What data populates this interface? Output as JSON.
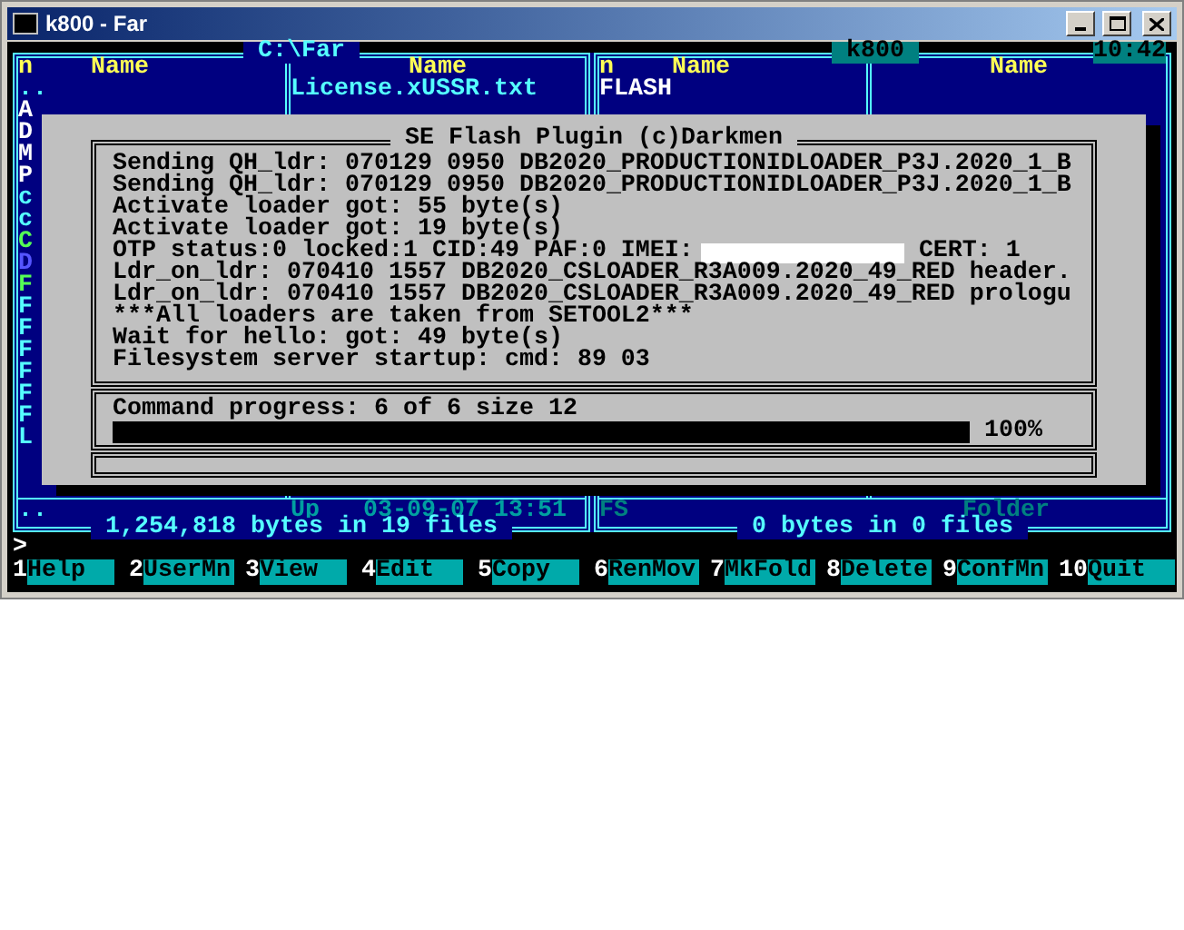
{
  "window": {
    "title": "k800 - Far"
  },
  "left_panel": {
    "title": "C:\\Far",
    "headers": [
      "n",
      "Name",
      "Name"
    ],
    "column_1": [
      {
        "text": "..",
        "color": "#55ffff"
      },
      {
        "text": "A",
        "color": "#ffffff"
      },
      {
        "text": "D",
        "color": "#ffffff"
      },
      {
        "text": "M",
        "color": "#ffffff"
      },
      {
        "text": "P",
        "color": "#ffffff"
      },
      {
        "text": "c",
        "color": "#55ffff"
      },
      {
        "text": "c",
        "color": "#55ffff"
      },
      {
        "text": "C",
        "color": "#55ff55"
      },
      {
        "text": "D",
        "color": "#5555ff"
      },
      {
        "text": "F",
        "color": "#55ff55"
      },
      {
        "text": "F",
        "color": "#55ffff"
      },
      {
        "text": "F",
        "color": "#55ffff"
      },
      {
        "text": "F",
        "color": "#55ffff"
      },
      {
        "text": "F",
        "color": "#55ffff"
      },
      {
        "text": "F",
        "color": "#55ffff"
      },
      {
        "text": "F",
        "color": "#55ffff"
      },
      {
        "text": "L",
        "color": "#55ffff"
      }
    ],
    "column_2": [
      "License.xUSSR.txt"
    ],
    "info": {
      "name": "..",
      "status": "Up",
      "date": "03-09-07",
      "time": "13:51"
    },
    "summary": "1,254,818 bytes in 19 files"
  },
  "right_panel": {
    "title": "k800",
    "clock": "10:42",
    "headers": [
      "n",
      "Name",
      "Name"
    ],
    "column_1": [
      {
        "text": "FLASH",
        "color": "#ffffff"
      }
    ],
    "info": {
      "name": "FS",
      "type": "Folder"
    },
    "summary": "0 bytes in 0 files"
  },
  "dialog": {
    "title": "SE Flash Plugin (c)Darkmen",
    "log": [
      {
        "text": "Sending QH_ldr: 070129 0950 DB2020_PRODUCTIONIDLOADER_P3J.2020_1_B",
        "redacted": false
      },
      {
        "text": "Sending QH_ldr: 070129 0950 DB2020_PRODUCTIONIDLOADER_P3J.2020_1_B",
        "redacted": false
      },
      {
        "text": "Activate loader got: 55 byte(s)",
        "redacted": false
      },
      {
        "text": "Activate loader got: 19 byte(s)",
        "redacted": false
      },
      {
        "text": "OTP status:0 locked:1 CID:49 PAF:0 IMEI:",
        "redacted": true,
        "text_after": "CERT: 1"
      },
      {
        "text": "Ldr_on_ldr: 070410 1557 DB2020_CSLOADER_R3A009.2020_49_RED header.",
        "redacted": false
      },
      {
        "text": "Ldr_on_ldr: 070410 1557 DB2020_CSLOADER_R3A009.2020_49_RED prologu",
        "redacted": false
      },
      {
        "text": "***All loaders are taken from SETOOL2***",
        "redacted": false
      },
      {
        "text": "Wait for hello:  got: 49 byte(s)",
        "redacted": false
      },
      {
        "text": "Filesystem server startup: cmd: 89 03",
        "redacted": false
      }
    ],
    "progress": {
      "label": "Command progress: 6 of 6  size 12",
      "level": 1,
      "percent": "100%"
    }
  },
  "prompt": ">",
  "keybar": [
    {
      "key": "1",
      "label": "Help"
    },
    {
      "key": "2",
      "label": "UserMn"
    },
    {
      "key": "3",
      "label": "View"
    },
    {
      "key": "4",
      "label": "Edit"
    },
    {
      "key": "5",
      "label": "Copy"
    },
    {
      "key": "6",
      "label": "RenMov"
    },
    {
      "key": "7",
      "label": "MkFold"
    },
    {
      "key": "8",
      "label": "Delete"
    },
    {
      "key": "9",
      "label": "ConfMn"
    },
    {
      "key": "10",
      "label": "Quit"
    }
  ]
}
